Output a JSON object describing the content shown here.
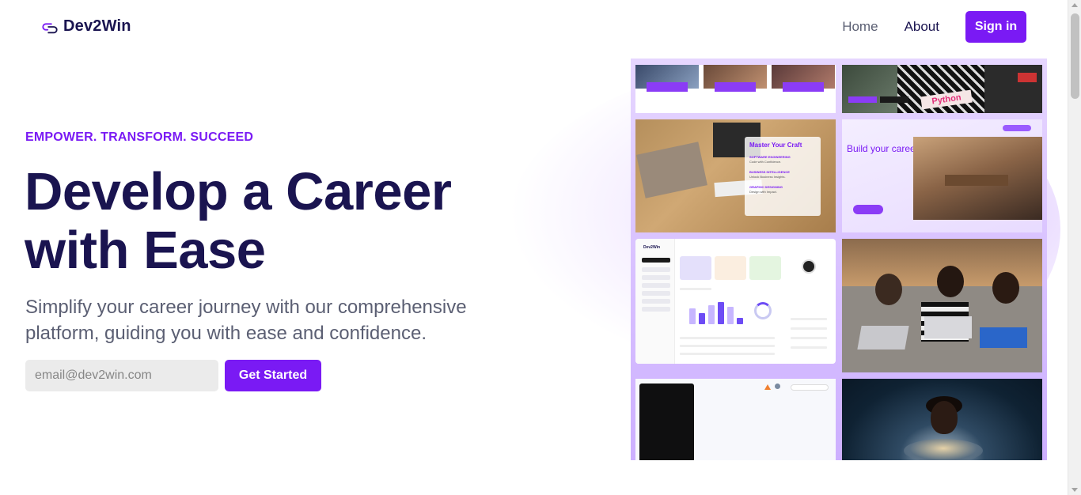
{
  "header": {
    "brand": "Dev2Win",
    "nav": {
      "home": "Home",
      "about": "About"
    },
    "signin_label": "Sign in"
  },
  "hero": {
    "eyebrow": "EMPOWER. TRANSFORM. SUCCEED",
    "title": "Develop a Career with Ease",
    "subtitle": "Simplify your career journey with our comprehensive platform, guiding you with ease and confidence.",
    "email_placeholder": "email@dev2win.com",
    "cta_label": "Get Started"
  },
  "gallery": {
    "tile_desk": {
      "title": "Master Your Craft",
      "items": [
        {
          "label": "SOFTWARE ENGINEERING",
          "sub": "Code with Confidence."
        },
        {
          "label": "BUSINESS INTELLIGENCE",
          "sub": "Unlock Business Insights."
        },
        {
          "label": "GRAPHIC DESIGNING",
          "sub": "Design with Impact."
        }
      ]
    },
    "tile_build": {
      "title": "Build your career"
    },
    "tile_dashboard": {
      "brand": "Dev2Win"
    },
    "tile_python": {
      "sign": "Python"
    }
  },
  "colors": {
    "accent": "#7a1af4",
    "heading": "#1a1450",
    "muted": "#5b5f73",
    "input_bg": "#ebebeb"
  },
  "icons": {
    "logo": "link-icon"
  }
}
